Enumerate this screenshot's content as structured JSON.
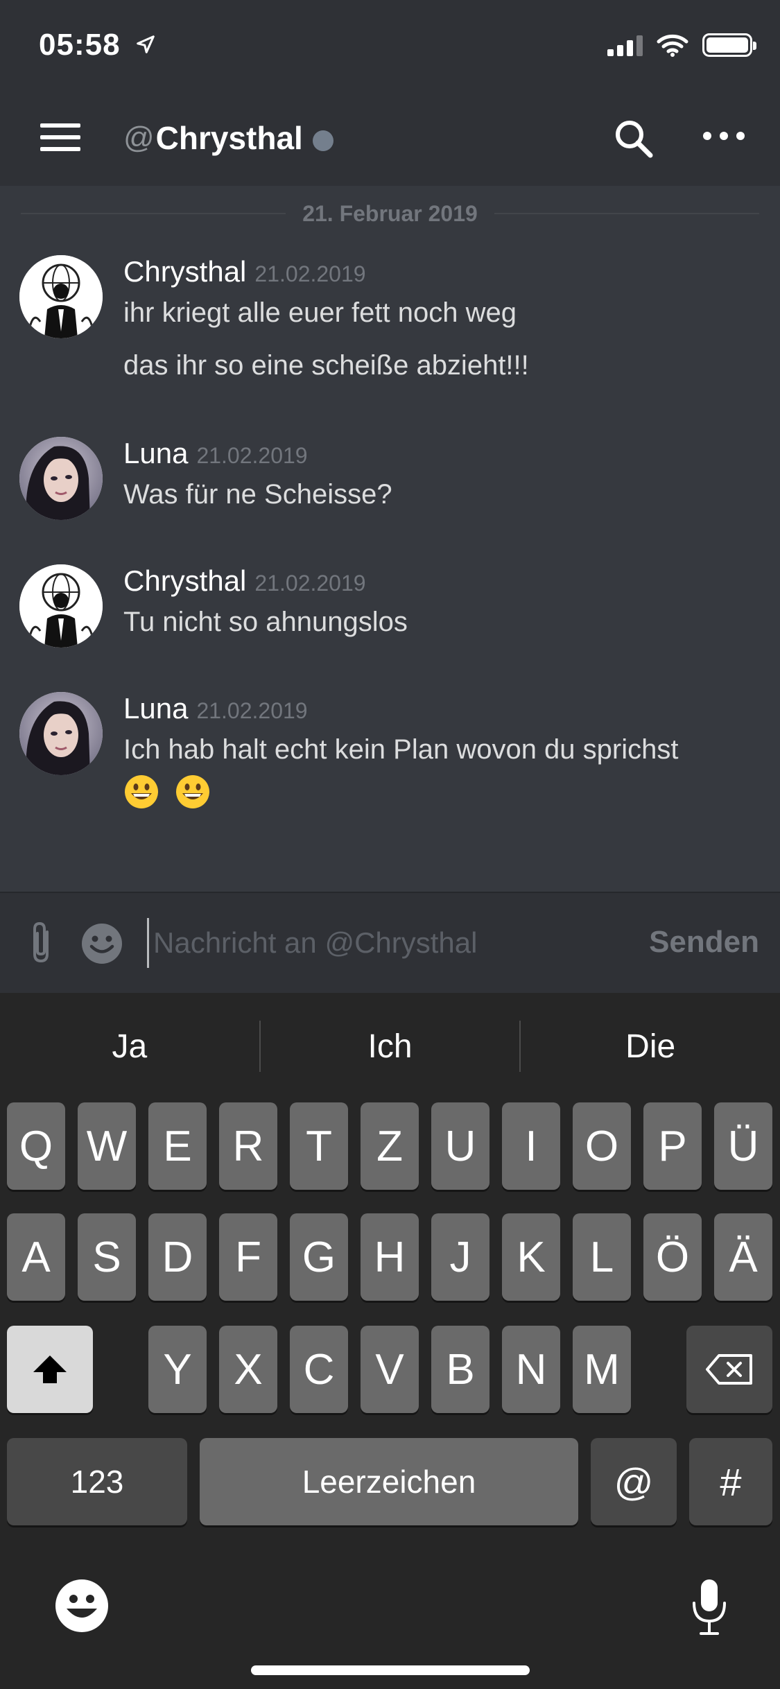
{
  "status_bar": {
    "time": "05:58"
  },
  "header": {
    "at_symbol": "@",
    "channel_name": "Chrysthal"
  },
  "chat": {
    "date_divider": "21. Februar 2019",
    "messages": [
      {
        "author": "Chrysthal",
        "timestamp": "21.02.2019",
        "lines": [
          "ihr kriegt alle euer fett noch weg",
          "das ihr so eine scheiße abzieht!!!"
        ],
        "avatar": "anonymous-mask-avatar"
      },
      {
        "author": "Luna",
        "timestamp": "21.02.2019",
        "lines": [
          "Was für ne Scheisse?"
        ],
        "avatar": "user-photo-avatar"
      },
      {
        "author": "Chrysthal",
        "timestamp": "21.02.2019",
        "lines": [
          "Tu nicht so ahnungslos"
        ],
        "avatar": "anonymous-mask-avatar"
      },
      {
        "author": "Luna",
        "timestamp": "21.02.2019",
        "lines": [
          "Ich hab halt echt kein Plan wovon du sprichst"
        ],
        "emojis": [
          "grinning-face-emoji",
          "grinning-face-emoji"
        ],
        "avatar": "user-photo-avatar"
      }
    ]
  },
  "composer": {
    "placeholder": "Nachricht an @Chrysthal",
    "value": "",
    "send_label": "Senden"
  },
  "keyboard": {
    "suggestions": [
      "Ja",
      "Ich",
      "Die"
    ],
    "row1": [
      "Q",
      "W",
      "E",
      "R",
      "T",
      "Z",
      "U",
      "I",
      "O",
      "P",
      "Ü"
    ],
    "row2": [
      "A",
      "S",
      "D",
      "F",
      "G",
      "H",
      "J",
      "K",
      "L",
      "Ö",
      "Ä"
    ],
    "row3": [
      "Y",
      "X",
      "C",
      "V",
      "B",
      "N",
      "M"
    ],
    "numbers_label": "123",
    "space_label": "Leerzeichen",
    "at_label": "@",
    "hash_label": "#"
  },
  "colors": {
    "header_bg": "#2f3136",
    "chat_bg": "#36393f",
    "keyboard_bg": "#262626",
    "key_bg": "#6a6a6a",
    "timestamp": "#72767d",
    "presence_offline": "#747f8d"
  }
}
